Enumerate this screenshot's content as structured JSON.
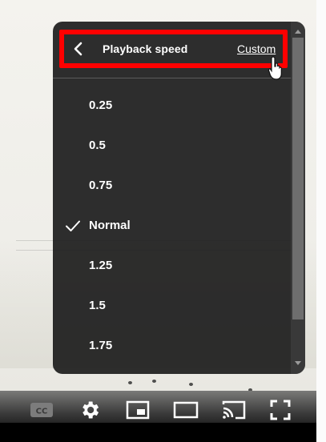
{
  "menu": {
    "title": "Playback speed",
    "custom_label": "Custom",
    "options": [
      {
        "label": "0.25",
        "selected": false
      },
      {
        "label": "0.5",
        "selected": false
      },
      {
        "label": "0.75",
        "selected": false
      },
      {
        "label": "Normal",
        "selected": true
      },
      {
        "label": "1.25",
        "selected": false
      },
      {
        "label": "1.5",
        "selected": false
      },
      {
        "label": "1.75",
        "selected": false
      }
    ]
  },
  "controls": {
    "icons": [
      "subtitles-cc-icon",
      "settings-gear-icon",
      "miniplayer-icon",
      "theater-mode-icon",
      "cast-icon",
      "fullscreen-icon"
    ],
    "cc_label": "CC"
  },
  "colors": {
    "highlight": "#ff0000",
    "menu_bg": "#1c1c1c",
    "text": "#ffffff"
  }
}
